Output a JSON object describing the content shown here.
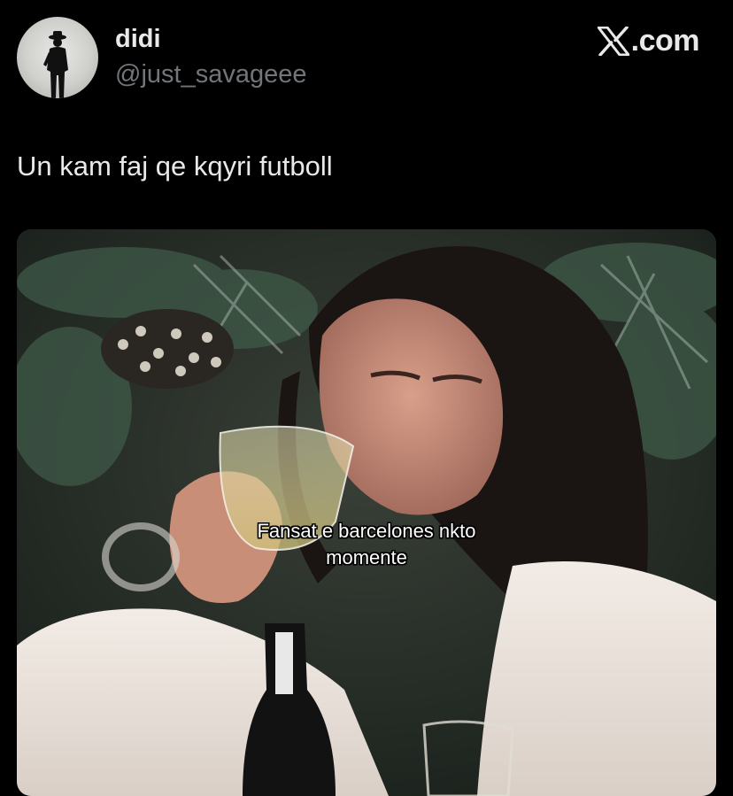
{
  "author": {
    "display_name": "didi",
    "handle": "@just_savageee",
    "avatar_icon": "silhouette-avatar-icon"
  },
  "brand": {
    "label": ".com",
    "logo_icon": "x-logo-icon"
  },
  "tweet": {
    "text": "Un kam faj qe kqyri futboll"
  },
  "media": {
    "caption_line1": "Fansat e barcelones nkto",
    "caption_line2": "momente"
  }
}
